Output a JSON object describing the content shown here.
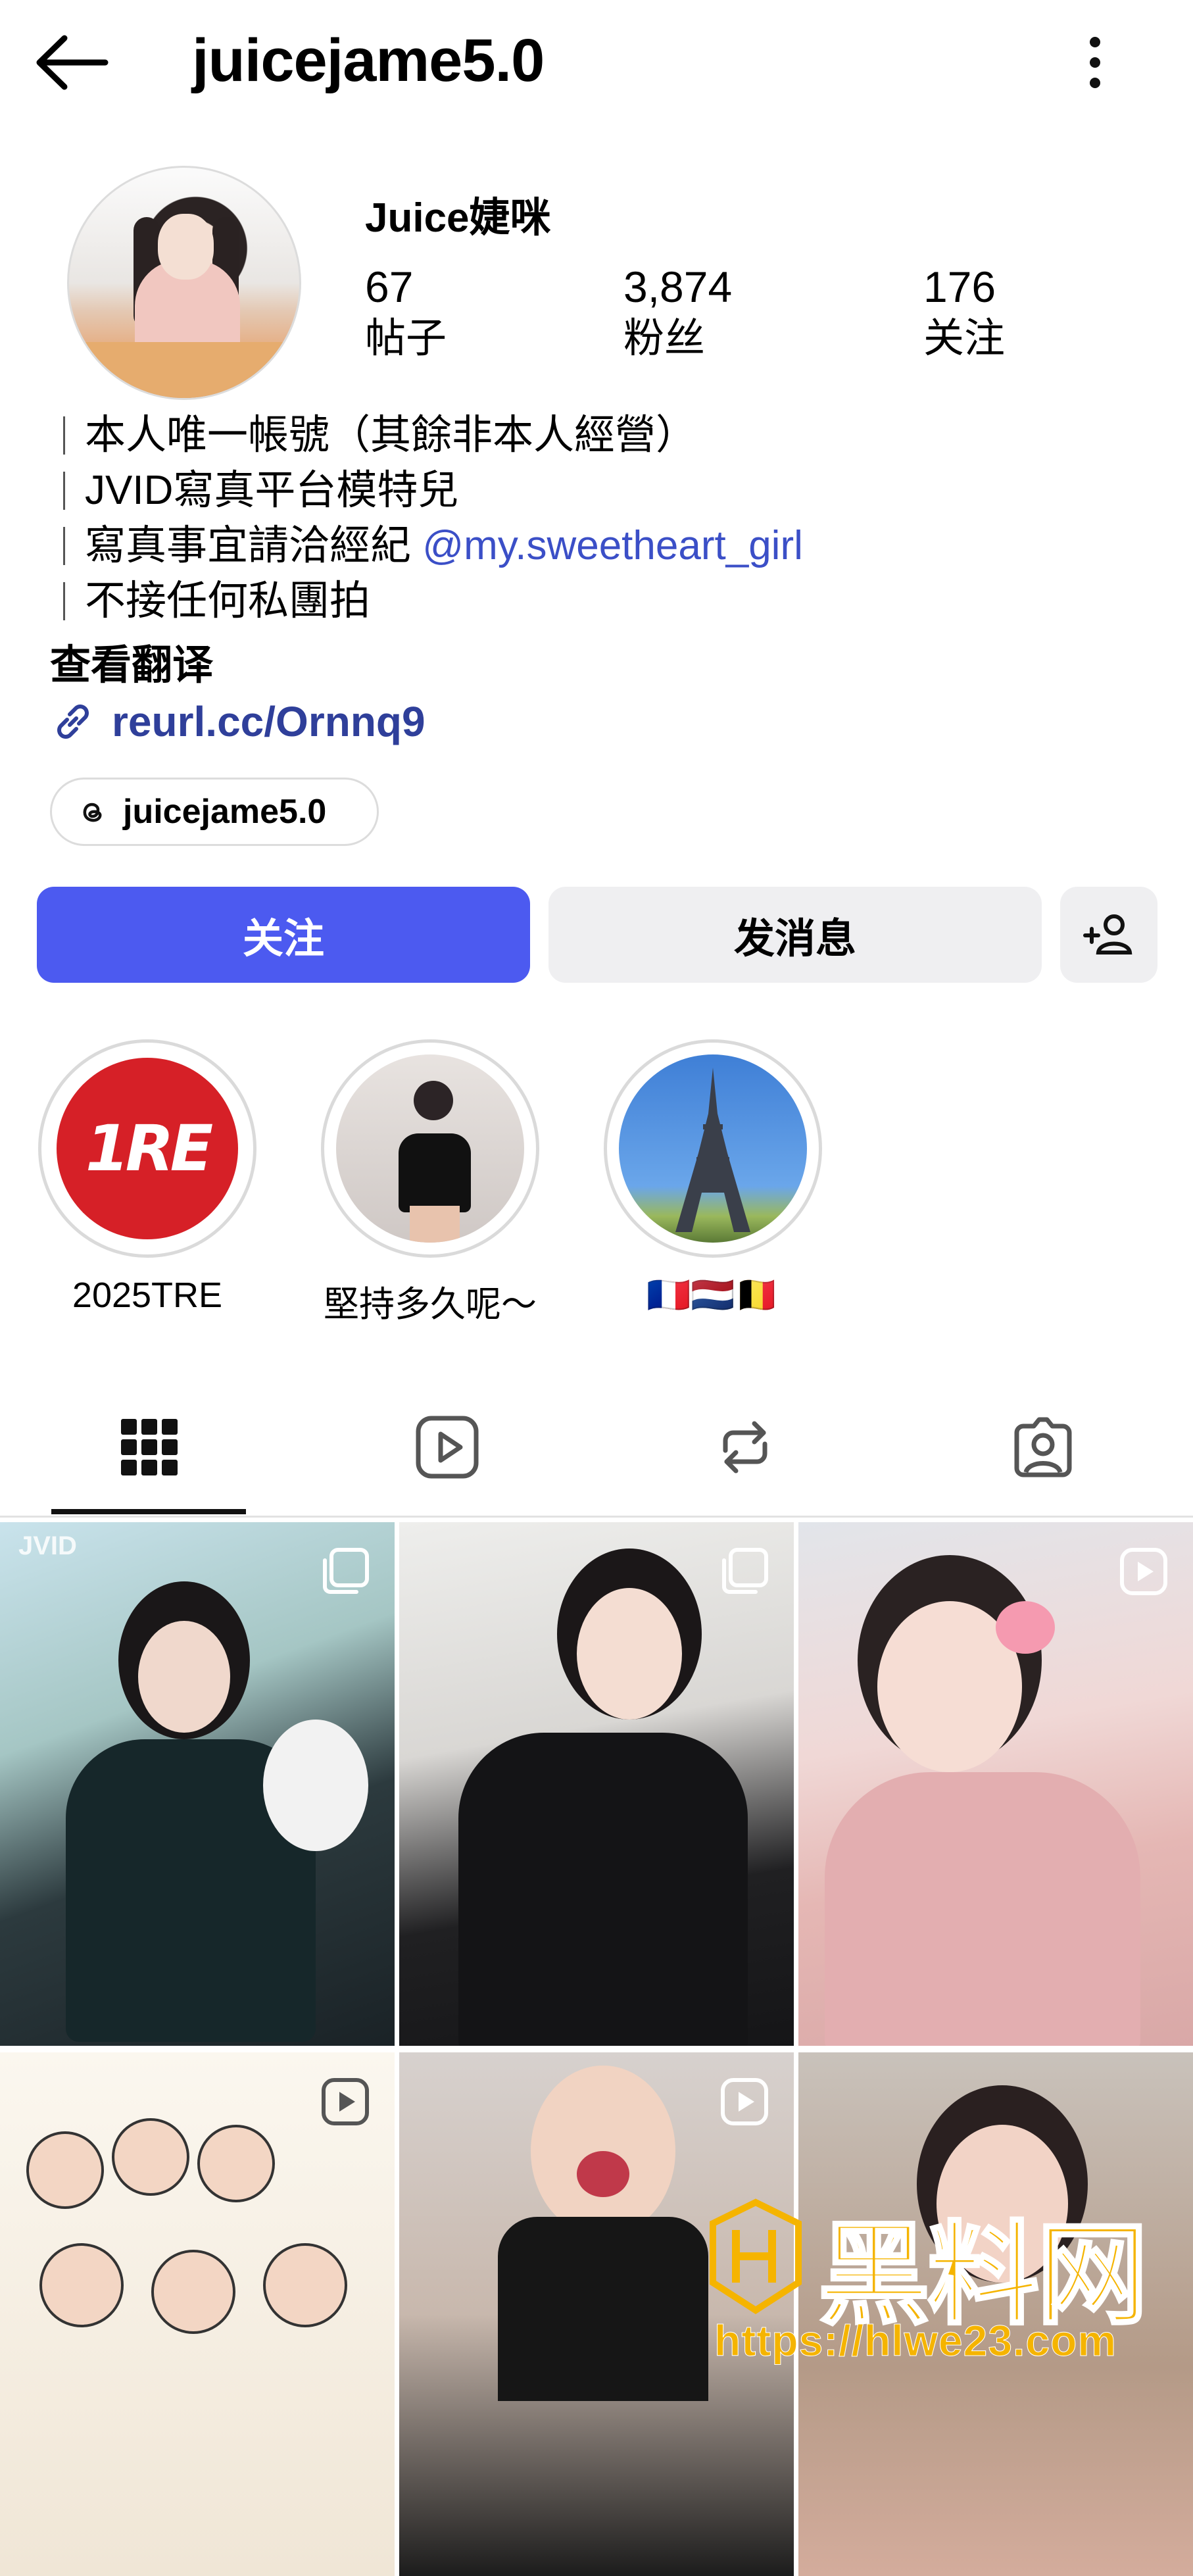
{
  "header": {
    "username": "juicejame5.0",
    "back_icon": "arrow-left-icon",
    "more_icon": "more-vertical-icon"
  },
  "profile": {
    "display_name": "Juice婕咪",
    "stats": [
      {
        "value": "67",
        "label": "帖子"
      },
      {
        "value": "3,874",
        "label": "粉丝"
      },
      {
        "value": "176",
        "label": "关注"
      }
    ],
    "bio": [
      {
        "text": "本人唯一帳號（其餘非本人經營）"
      },
      {
        "text": "JVID寫真平台模特兒"
      },
      {
        "text": "寫真事宜請洽經紀 ",
        "mention": "@my.sweetheart_girl"
      },
      {
        "text": "不接任何私團拍"
      }
    ],
    "translate_label": "查看翻译",
    "link": "reurl.cc/Ornnq9",
    "threads_handle": "juicejame5.0"
  },
  "actions": {
    "follow_label": "关注",
    "message_label": "发消息"
  },
  "highlights": [
    {
      "label": "2025TRE",
      "logo_text": "1RE"
    },
    {
      "label": "堅持多久呢～"
    },
    {
      "label": "🇫🇷🇳🇱🇧🇪"
    }
  ],
  "tabs": [
    "grid-icon",
    "reels-icon",
    "reposts-icon",
    "tagged-icon"
  ],
  "grid": {
    "watermark_text": "JVID",
    "items": [
      {
        "type": "carousel"
      },
      {
        "type": "carousel"
      },
      {
        "type": "reel"
      },
      {
        "type": "reel"
      },
      {
        "type": "reel"
      },
      {
        "type": "image"
      }
    ]
  },
  "watermark": {
    "title": "黑料网",
    "url": "https://hlwe23.com"
  },
  "colors": {
    "accent": "#4c5af0",
    "link": "#2f3f9a",
    "mention": "#3b4fc7",
    "watermark": "#f5b400"
  }
}
